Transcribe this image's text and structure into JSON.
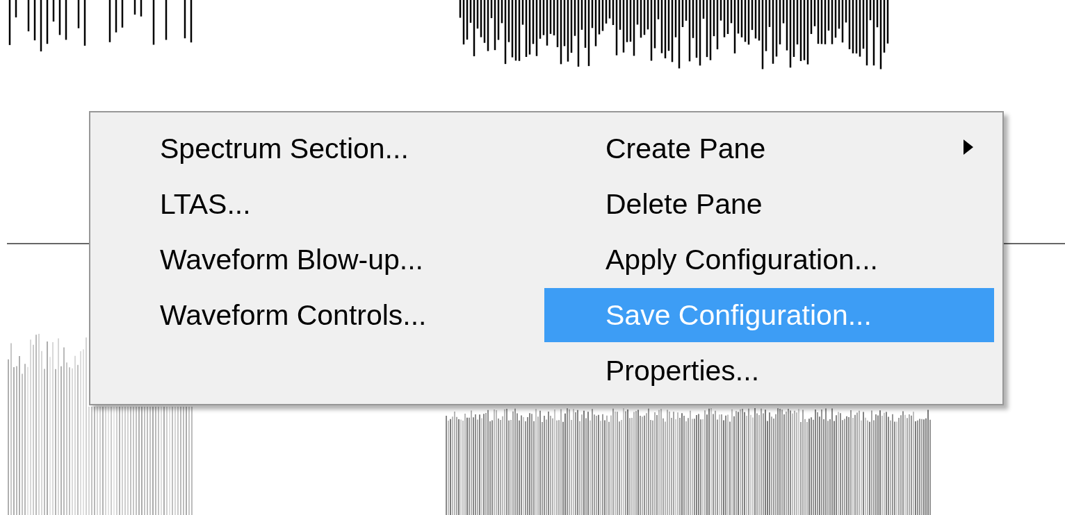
{
  "context_menu": {
    "columns": [
      {
        "items": [
          {
            "label": "Spectrum Section...",
            "selected": false,
            "has_submenu": false
          },
          {
            "label": "LTAS...",
            "selected": false,
            "has_submenu": false
          },
          {
            "label": "Waveform Blow-up...",
            "selected": false,
            "has_submenu": false
          },
          {
            "label": "Waveform Controls...",
            "selected": false,
            "has_submenu": false
          }
        ]
      },
      {
        "items": [
          {
            "label": "Create Pane",
            "selected": false,
            "has_submenu": true
          },
          {
            "label": "Delete Pane",
            "selected": false,
            "has_submenu": false
          },
          {
            "label": "Apply Configuration...",
            "selected": false,
            "has_submenu": false
          },
          {
            "label": "Save Configuration...",
            "selected": true,
            "has_submenu": false
          },
          {
            "label": "Properties...",
            "selected": false,
            "has_submenu": false
          }
        ]
      }
    ]
  }
}
